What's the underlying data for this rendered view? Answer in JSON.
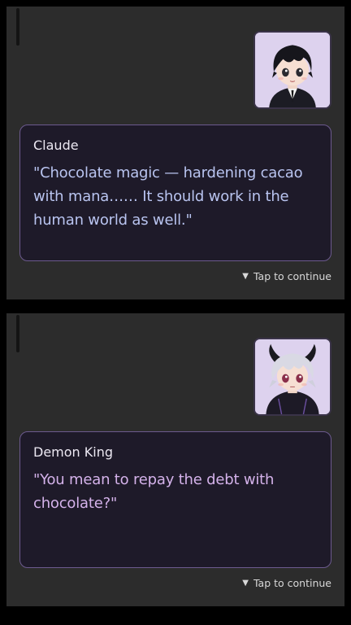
{
  "scenes": [
    {
      "speaker": "Claude",
      "text": "\"Chocolate magic — hardening cacao with mana…… It should work in the human world as well.\"",
      "continue_label": "Tap to continue",
      "continue_icon": "▼"
    },
    {
      "speaker": "Demon King",
      "text": "\"You mean to repay the debt with chocolate?\"",
      "continue_label": "Tap to continue",
      "continue_icon": "▼"
    }
  ],
  "colors": {
    "panel_bg": "#2c2c2c",
    "dialog_bg": "#1e1a29",
    "dialog_border": "#6c5a8e",
    "portrait_bg": "#d9cfeb",
    "claude_text": "#b9c4f0",
    "demon_king_text": "#d4b2ea"
  }
}
